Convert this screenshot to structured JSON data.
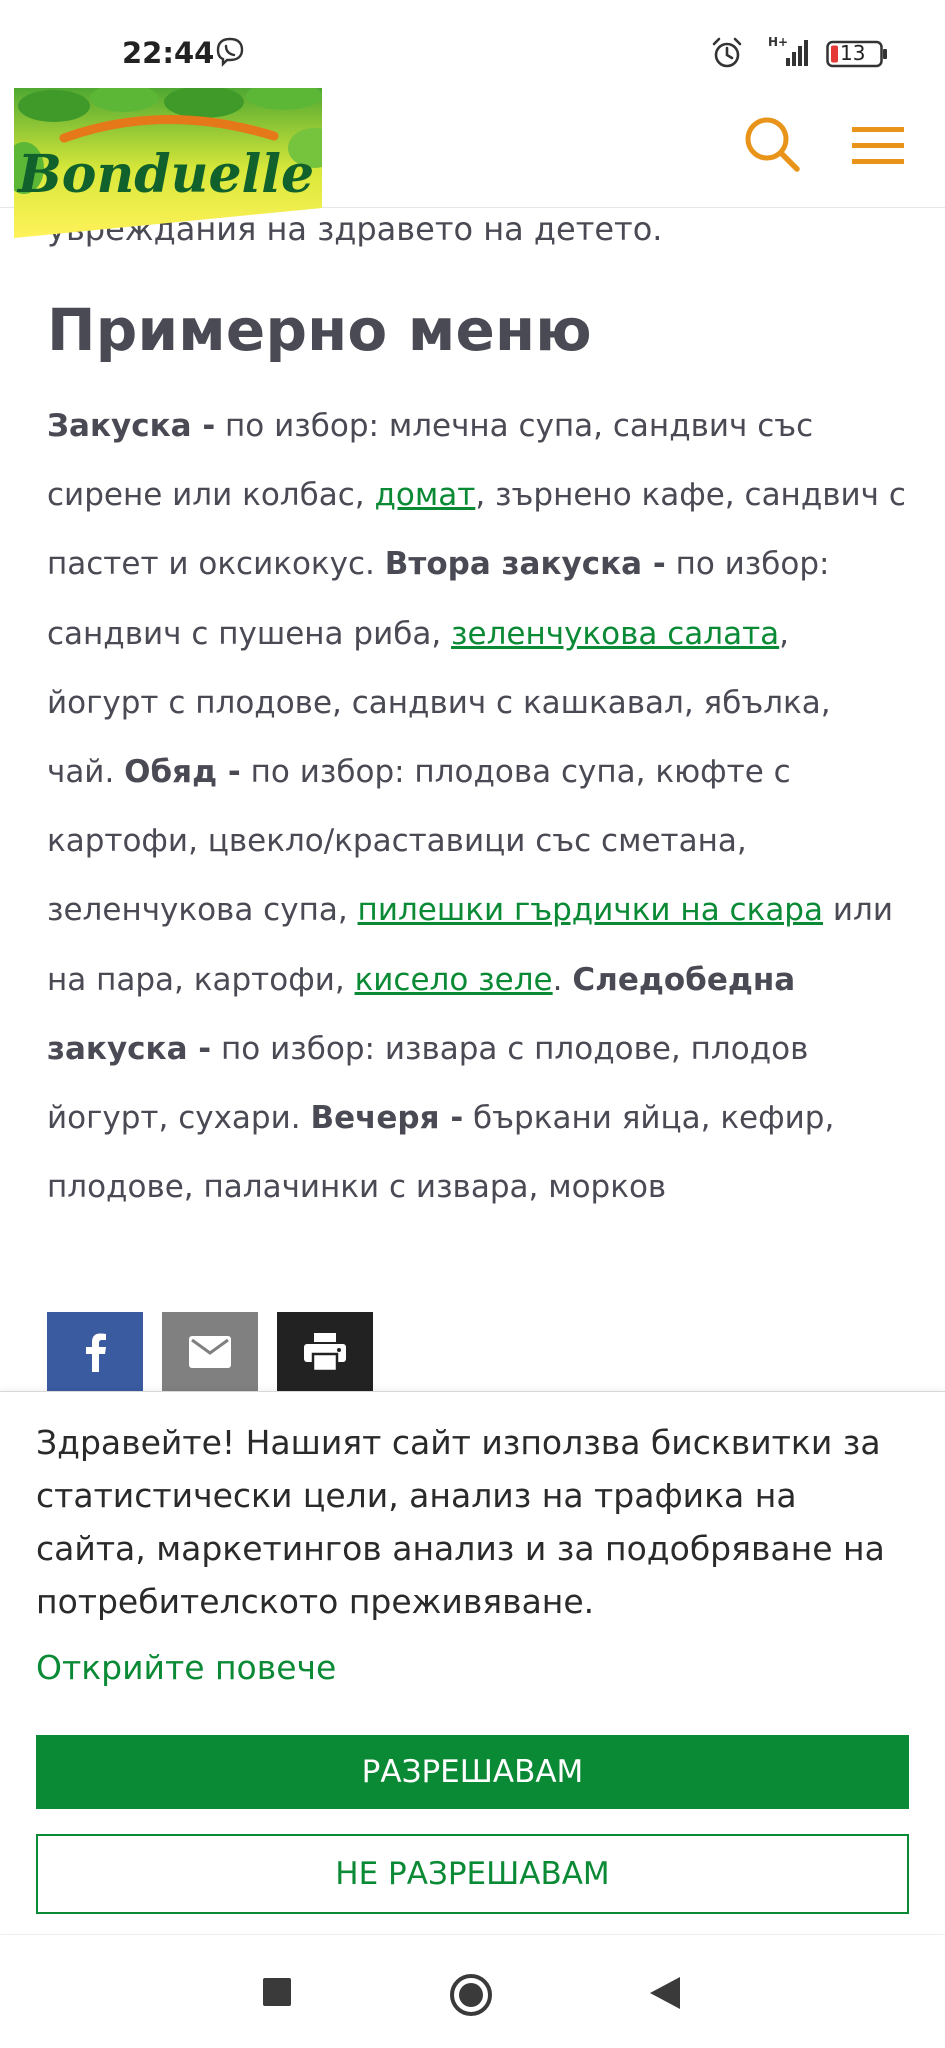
{
  "status_bar": {
    "time": "22:44",
    "network": "H+",
    "battery": "13",
    "icons": [
      "viber-icon",
      "alarm-icon",
      "signal-icon",
      "battery-icon"
    ]
  },
  "header": {
    "logo_text": "Bonduelle",
    "icons": [
      "search-icon",
      "menu-icon"
    ],
    "accent_color": "#E8941A"
  },
  "article": {
    "cut_text": "увреждания на здравето на детето.",
    "title": "Примерно меню",
    "body": {
      "s1_label": "Закуска -",
      "s1_text_a": " по избор: млечна супа, сандвич със сирене или колбас, ",
      "s1_link": "домат",
      "s1_text_b": ", зърнено кафе, сандвич с пастет и оксикокус. ",
      "s2_label": "Втора закуска -",
      "s2_text_a": " по избор: сандвич с пушена риба, ",
      "s2_link": "зеленчукова салата",
      "s2_text_b": ", йогурт с плодове, сандвич с кашкавал, ябълка, чай. ",
      "s3_label": "Обяд -",
      "s3_text_a": " по избор: плодова супа, кюфте с картофи, цвекло/краставици със сметана, зеленчукова супа, ",
      "s3_link1": "пилешки гърдички на скара",
      "s3_text_b": " или на пара, картофи, ",
      "s3_link2": "кисело зеле",
      "s3_text_c": ". ",
      "s4_label": "Следобедна закуска -",
      "s4_text": " по избор: извара с плодове, плодов йогурт, сухари. ",
      "s5_label": "Вечеря -",
      "s5_text": " бъркани яйца, кефир, плодове, палачинки с извара, морков"
    },
    "link_color": "#0B8A36"
  },
  "share": {
    "icons": [
      "facebook-icon",
      "mail-icon",
      "print-icon"
    ],
    "colors": [
      "#3A5BA0",
      "#808080",
      "#222222"
    ]
  },
  "cookie_banner": {
    "text": "Здравейте! Нашият сайт използва бисквитки за статистически цели, анализ на трафика на сайта, маркетингов анализ и за подобряване на потребителското преживяване.",
    "learn_more": "Открийте повече",
    "accept": "РАЗРЕШАВАМ",
    "decline": "НЕ РАЗРЕШАВАМ",
    "brand_color": "#0B8A36"
  },
  "nav_bar": {
    "icons": [
      "recent-apps-icon",
      "home-icon",
      "back-icon"
    ]
  }
}
